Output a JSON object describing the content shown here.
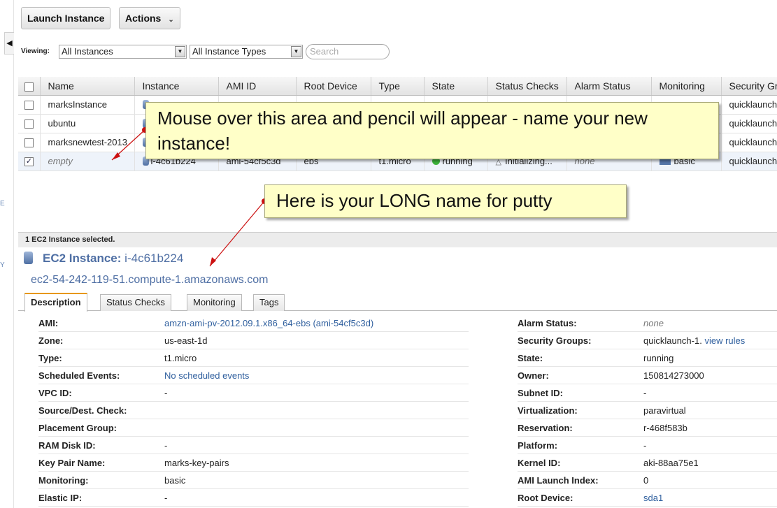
{
  "toolbar": {
    "launch_label": "Launch Instance",
    "actions_label": "Actions"
  },
  "viewing": {
    "label": "Viewing:",
    "filter_instances": "All Instances",
    "filter_types": "All Instance Types",
    "search_placeholder": "Search"
  },
  "left_strip": {
    "stray_e": "E",
    "stray_y": "Y"
  },
  "grid": {
    "columns": [
      "Name",
      "Instance",
      "AMI ID",
      "Root Device",
      "Type",
      "State",
      "Status Checks",
      "Alarm Status",
      "Monitoring",
      "Security Gr"
    ],
    "rows": [
      {
        "name": "marksInstance"
      },
      {
        "name": "ubuntu"
      },
      {
        "name": "marksnewtest-2013"
      },
      {
        "name": "empty",
        "instance": "i-4c61b224",
        "ami": "ami-54cf5c3d",
        "root": "ebs",
        "type": "t1.micro",
        "state": "running",
        "status": "Initializing...",
        "alarm": "none",
        "monitoring": "basic",
        "security": "quicklaunch"
      }
    ],
    "security_short": "quicklaunch"
  },
  "callouts": {
    "pencil": "Mouse over this area and pencil will appear - name your new instance!",
    "longname": "Here is your LONG name for putty"
  },
  "selection": {
    "bar": "1 EC2 Instance selected.",
    "title_prefix": "EC2 Instance:",
    "instance_id": "i-4c61b224",
    "public_dns": "ec2-54-242-119-51.compute-1.amazonaws.com"
  },
  "tabs": [
    "Description",
    "Status Checks",
    "Monitoring",
    "Tags"
  ],
  "description": {
    "left": [
      {
        "key": "AMI:",
        "value": "amzn-ami-pv-2012.09.1.x86_64-ebs (ami-54cf5c3d)"
      },
      {
        "key": "Zone:",
        "value": "us-east-1d"
      },
      {
        "key": "Type:",
        "value": "t1.micro"
      },
      {
        "key": "Scheduled Events:",
        "value": "No scheduled events"
      },
      {
        "key": "VPC ID:",
        "value": "-"
      },
      {
        "key": "Source/Dest. Check:",
        "value": ""
      },
      {
        "key": "Placement Group:",
        "value": ""
      },
      {
        "key": "RAM Disk ID:",
        "value": "-"
      },
      {
        "key": "Key Pair Name:",
        "value": "marks-key-pairs"
      },
      {
        "key": "Monitoring:",
        "value": "basic"
      },
      {
        "key": "Elastic IP:",
        "value": "-"
      }
    ],
    "right": [
      {
        "key": "Alarm Status:",
        "value": "none"
      },
      {
        "key": "Security Groups:",
        "value": "quicklaunch-1.",
        "link": "view rules"
      },
      {
        "key": "State:",
        "value": "running"
      },
      {
        "key": "Owner:",
        "value": "150814273000"
      },
      {
        "key": "Subnet ID:",
        "value": "-"
      },
      {
        "key": "Virtualization:",
        "value": "paravirtual"
      },
      {
        "key": "Reservation:",
        "value": "r-468f583b"
      },
      {
        "key": "Platform:",
        "value": "-"
      },
      {
        "key": "Kernel ID:",
        "value": "aki-88aa75e1"
      },
      {
        "key": "AMI Launch Index:",
        "value": "0"
      },
      {
        "key": "Root Device:",
        "value": "sda1"
      }
    ]
  }
}
